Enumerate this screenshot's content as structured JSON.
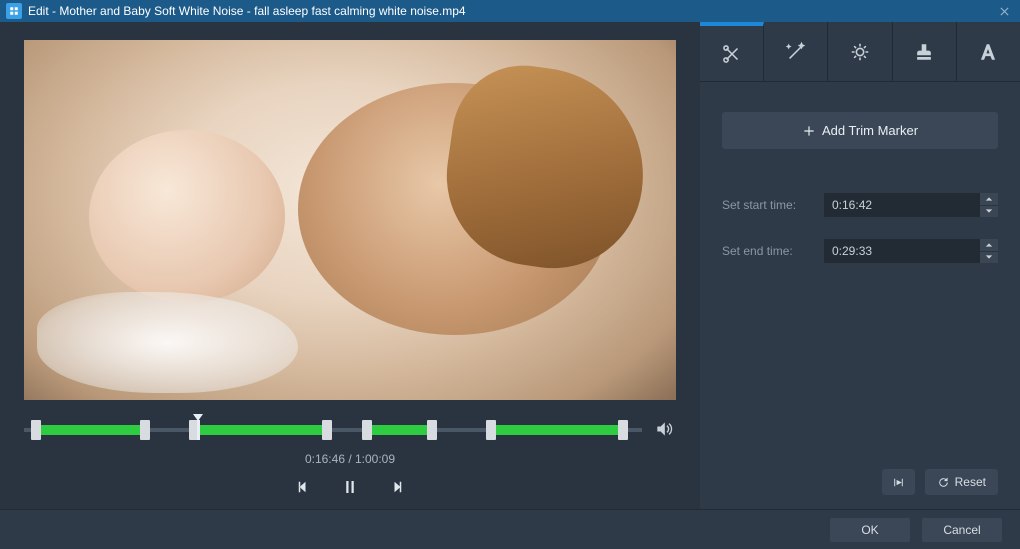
{
  "titlebar": {
    "prefix": "Edit",
    "filename": "Mother and Baby Soft White Noise - fall asleep fast  calming white noise.mp4"
  },
  "tabs": {
    "trim": "scissors-icon",
    "effects": "magic-wand-icon",
    "adjust": "brightness-icon",
    "watermark": "stamp-icon",
    "text": "text-icon"
  },
  "trim_panel": {
    "add_marker_label": "Add Trim Marker",
    "start_label": "Set start time:",
    "start_value": "0:16:42",
    "end_label": "Set end time:",
    "end_value": "0:29:33",
    "reset_label": "Reset"
  },
  "player": {
    "current_time": "0:16:46",
    "total_time": "1:00:09",
    "time_display": "0:16:46 / 1:00:09"
  },
  "timeline_segments": [
    {
      "start_pct": 2,
      "end_pct": 19.5,
      "handles": true
    },
    {
      "start_pct": 27.5,
      "end_pct": 49,
      "handles": true
    },
    {
      "start_pct": 55.5,
      "end_pct": 66,
      "handles": true
    },
    {
      "start_pct": 75.5,
      "end_pct": 97,
      "handles": true
    }
  ],
  "playhead_pct": 28,
  "footer": {
    "ok_label": "OK",
    "cancel_label": "Cancel"
  }
}
